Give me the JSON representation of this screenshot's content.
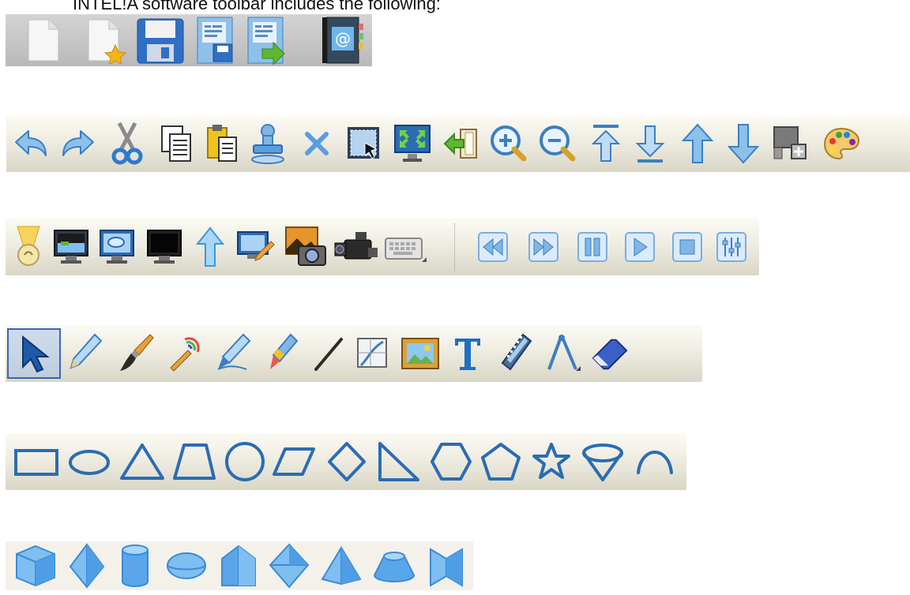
{
  "caption": "INTEL!A software toolbar includes the following:",
  "toolbars": {
    "file": [
      "new-file-icon",
      "open-template-icon",
      "save-floppy-icon",
      "save-notebook-icon",
      "export-notebook-icon",
      "address-book-icon"
    ],
    "edit": [
      "undo-icon",
      "redo-icon",
      "cut-scissors-icon",
      "copy-icon",
      "paste-icon",
      "stamp-icon",
      "delete-icon",
      "select-area-icon",
      "fullscreen-icon",
      "back-page-icon",
      "zoom-in-icon",
      "zoom-out-icon",
      "move-top-icon",
      "move-bottom-icon",
      "move-up-icon",
      "move-down-icon",
      "group-icon",
      "color-palette-icon"
    ],
    "presentation": [
      "spotlight-icon",
      "screen-shade-icon",
      "screen-display-icon",
      "black-screen-icon",
      "upload-arrow-icon",
      "screen-annotate-icon",
      "screenshot-camera-icon",
      "video-camera-icon",
      "keyboard-icon",
      "rewind-icon",
      "fast-forward-icon",
      "pause-icon",
      "play-icon",
      "stop-icon",
      "equalizer-icon"
    ],
    "drawing": [
      "select-arrow-icon",
      "pencil-icon",
      "brush-icon",
      "texture-brush-icon",
      "pen-icon",
      "crayon-icon",
      "line-icon",
      "insert-shape-icon",
      "image-icon",
      "text-icon",
      "film-strip-icon",
      "compass-icon",
      "eraser-icon"
    ],
    "shapes": [
      "rectangle-icon",
      "ellipse-icon",
      "triangle-icon",
      "trapezoid-icon",
      "circle-icon",
      "parallelogram-icon",
      "diamond-icon",
      "right-triangle-icon",
      "hexagon-icon",
      "pentagon-icon",
      "star-icon",
      "inverted-cone-icon",
      "arc-icon"
    ],
    "solids": [
      "cube-icon",
      "octahedron-icon",
      "cylinder-icon",
      "flat-ellipsoid-icon",
      "prism-icon",
      "bipyramid-icon",
      "pyramid-icon",
      "frustum-icon",
      "folded-prism-icon"
    ]
  },
  "colors": {
    "stroke": "#2b6cb3",
    "fill": "#7fbef0",
    "fill_dark": "#3b8ad6",
    "yellow": "#f4c21a"
  }
}
